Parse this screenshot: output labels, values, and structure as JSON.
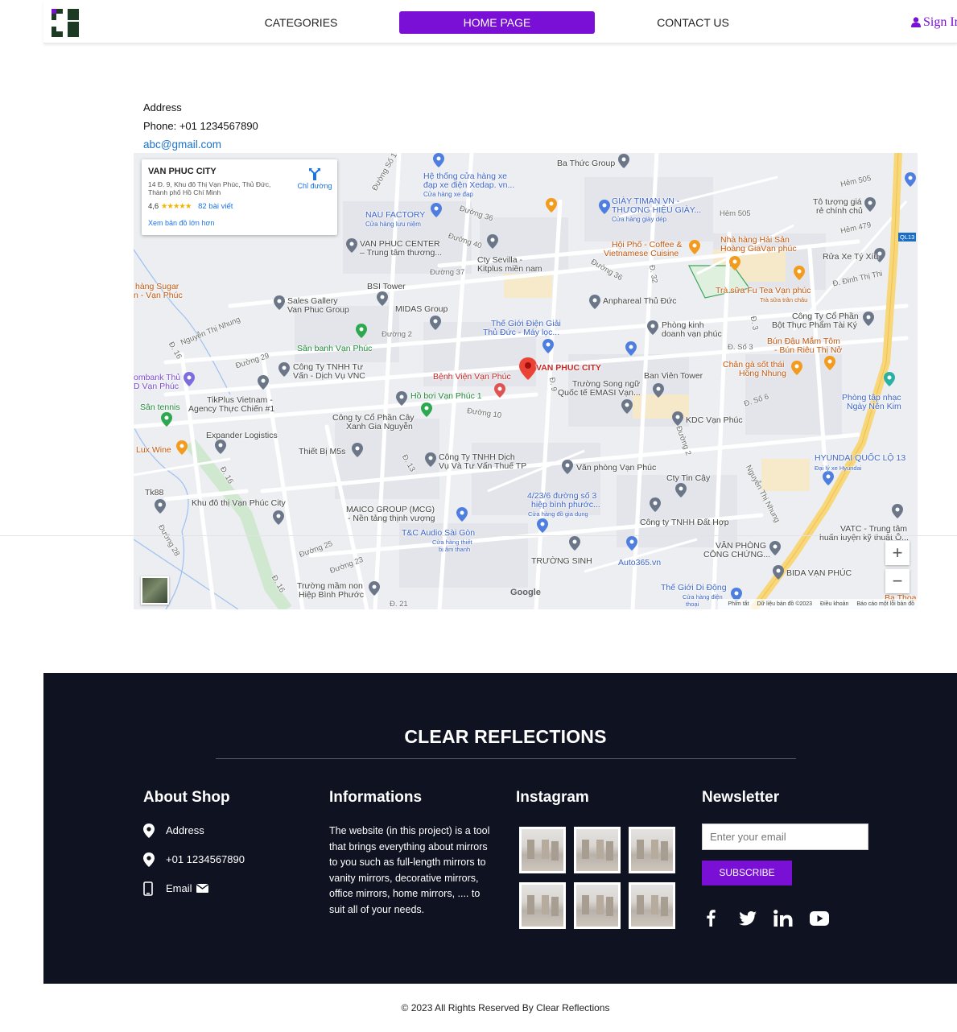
{
  "header": {
    "nav": {
      "categories": "CATEGORIES",
      "home": "HOME PAGE",
      "contact": "CONTACT US"
    },
    "sign_in": "Sign In",
    "accent": "#7a0fd6"
  },
  "contact": {
    "address_label": "Address",
    "phone": "Phone: +01 1234567890",
    "email": "abc@gmail.com"
  },
  "map": {
    "place_card": {
      "name": "VAN PHUC CITY",
      "address": "14 Đ. 9, Khu đô Thị Vạn Phúc, Thủ Đức, Thành phố Hồ Chí Minh",
      "rating": "4,6",
      "stars": "★★★★★",
      "reviews": "82 bài viết",
      "view_larger": "Xem bản đồ lớn hơn",
      "directions": "Chỉ đường"
    },
    "labels": {
      "ba_thuc": "Ba Thức Group",
      "he_thong": "Hệ thống cửa hàng xe",
      "he_thong2": "đạp xe điện Xedap. vn...",
      "he_thong3": "Cửa hàng xe đạp",
      "nau": "NAU FACTORY",
      "nau2": "Cửa hàng lưu niệm",
      "giay": "GIÀY TIMAN VN -",
      "giay2": "THƯƠNG HIỆU GIÀY...",
      "giay3": "Cửa hàng giày dép",
      "van_phuc_center": "VAN PHUC CENTER",
      "van_phuc_center2": "– Trung tâm thương...",
      "cty_sevilla": "Cty Sevilla -",
      "cty_sevilla2": "Kitplus miền nam",
      "hoi_pho": "Hội Phố - Coffee &",
      "hoi_pho2": "Vietnamese Cuisine",
      "nha_hang": "Nhà hàng Hải Sản",
      "nha_hang2": "Hoàng GiaVạn phúc",
      "rua_xe": "Rửa Xe Tý Xíu",
      "to_tuong": "Tô tượng giá",
      "to_tuong2": "rẻ chính chủ",
      "bsi": "BSI Tower",
      "sales_gallery": "Sales Gallery",
      "sales_gallery2": "Van Phuc Group",
      "midas": "MIDAS Group",
      "hang_sugar": "hàng Sugar",
      "hang_sugar2": "n - Vạn Phúc",
      "anphareal": "Anphareal Thủ Đức",
      "tra_sua": "Trà sữa Fu Tea Vạn phúc",
      "tra_sua2": "Trà sữa trân châu",
      "cty_co_phan": "Công Ty Cổ Phần",
      "cty_co_phan2": "Bột Thực Phẩm Tài Ký",
      "the_gioi_dien": "Thế Giới Điện Giải",
      "the_gioi_dien2": "Thủ Đức - Máy lọc...",
      "phong_kinh": "Phòng kinh",
      "phong_kinh2": "doanh vạn phúc",
      "bun_dau": "Bún Đậu Mắm Tôm",
      "bun_dau2": "- Bún Riêu Thị Nở",
      "san_banh": "Sân banh Vạn Phúc",
      "cty_vnc": "Công Ty TNHH Tư",
      "cty_vnc2": "Vấn - Dịch Vụ VNC",
      "van_phuc_city": "VAN PHUC CITY",
      "benh_vien": "Bệnh Viện Vạn Phúc",
      "ban_vien": "Ban Viên Tower",
      "cha_ga": "Chân gà sốt thái",
      "cha_ga2": "Hồng Nhung",
      "ombank": "ombank Thủ",
      "ombank2": "D Vạn Phúc",
      "tikplus": "TikPlus Vietnam -",
      "tikplus2": "Agency Thực Chiến #1",
      "ho_boi": "Hồ bơi Vạn Phúc 1",
      "truong_song_ngu": "Trường Song ngữ",
      "truong_song_ngu2": "Quốc tế EMASI Vạn...",
      "phong_tap": "Phòng tập nhạc",
      "phong_tap2": "Ngày Nên Kim",
      "san_tennis": "Sân tennis",
      "cty_cay_xanh": "Công ty Cổ Phần Cây",
      "cty_cay_xanh2": "Xanh Gia Nguyễn",
      "kdc": "KDC Vạn Phúc",
      "expander": "Expander Logistics",
      "lux_wine": "Lux Wine",
      "thiet_bi": "Thiết Bị M5s",
      "cty_dich_vu": "Công Ty TNHH Dịch",
      "cty_dich_vu2": "Vụ Và Tư Vấn Thuế TP",
      "van_phong": "Văn phòng Vạn Phúc",
      "hyundai": "HYUNDAI QUỐC LỘ 13",
      "hyundai2": "Đại lý xe Hyundai",
      "cty_tin_cay": "Cty Tin Cậy",
      "tk88": "Tk88",
      "khu_do_thi": "Khu đô thị Vạn Phúc City",
      "maico": "MAICO GROUP (MCG)",
      "maico2": "- Nền tảng thịnh vượng",
      "hiep_binh": "4/23/6 đường số 3",
      "hiep_binh2": "hiệp bình phước...",
      "hiep_binh3": "Cửa hàng đồ gia dụng",
      "dat_hop": "Công ty TNHH Đất Hợp",
      "vatc": "VATC - Trung tâm",
      "vatc2": "huấn luyện kỹ thuật Ô...",
      "tc_audio": "T&C Audio Sài Gòn",
      "tc_audio2": "Cửa hàng thiết",
      "tc_audio3": "bị âm thanh",
      "truong_sinh": "TRƯỜNG SINH",
      "auto365": "Auto365.vn",
      "van_phong_cong_chung": "VĂN PHÒNG",
      "van_phong_cong_chung2": "CÔNG CHỨNG...",
      "bida": "BIDA VẠN PHÚC",
      "mam_non": "Trường mầm non",
      "mam_non2": "Hiệp Bình Phước",
      "the_gioi_dd": "Thế Giới Di Động",
      "the_gioi_dd2": "Cửa hàng điện",
      "the_gioi_dd3": "thoại",
      "ba_thoa": "Ba Thoa",
      "ql13": "QL13",
      "hem505": "Hẻm 505",
      "hem505b": "Hẻm 505",
      "hem479": "Hẻm 479",
      "dinh_thi_thi": "Đ. Đinh Thị Thi",
      "nguyen_thi_nhung": "Nguyễn Thị Nhung",
      "nguyen_thi_nhung2": "Nguyễn Thị Nhung",
      "duong36": "Đường 36",
      "duong40": "Đường 40",
      "duong37": "Đường 37",
      "duong36b": "Đường 36",
      "duong2": "Đường 2",
      "duong29": "Đường 29",
      "duong10": "Đường 10",
      "duong25": "Đường 25",
      "duong23": "Đường 23",
      "duong28": "Đường 28",
      "duong_so": "Đường Số 1",
      "d16": "Đ. 16",
      "d16b": "Đ. 16",
      "d16c": "Đ. 16",
      "d13": "Đ. 13",
      "d9": "Đ. 9",
      "d32": "Đ. 32",
      "d21": "Đ. 21",
      "d3": "Đ. 3",
      "so3": "Đ. Số 3",
      "so6": "Đ. Số 6",
      "duong2b": "Đường 2",
      "google": "Google",
      "footer_keys": "Phím tắt",
      "footer_data": "Dữ liệu bản đồ ©2023",
      "footer_terms": "Điều khoản",
      "footer_report": "Báo cáo một lỗi bản đồ"
    }
  },
  "footer": {
    "brand": "CLEAR REFLECTIONS",
    "about": {
      "title": "About Shop",
      "address": "Address",
      "phone": "+01 1234567890",
      "email": "Email"
    },
    "info": {
      "title": "Informations",
      "text": "The website (in this project) is a tool that brings everything about mirrors to you such as full-length mirrors to vanity mirrors, decorative mirrors, office mirrors, home mirrors, .... to suit all of your needs."
    },
    "instagram": {
      "title": "Instagram"
    },
    "newsletter": {
      "title": "Newsletter",
      "placeholder": "Enter your email",
      "button": "SUBSCRIBE"
    },
    "social": [
      "facebook-icon",
      "twitter-icon",
      "linkedin-icon",
      "youtube-icon"
    ],
    "bg_color": "#0f1321"
  },
  "copyright": "© 2023 All Rights Reserved By Clear Reflections"
}
